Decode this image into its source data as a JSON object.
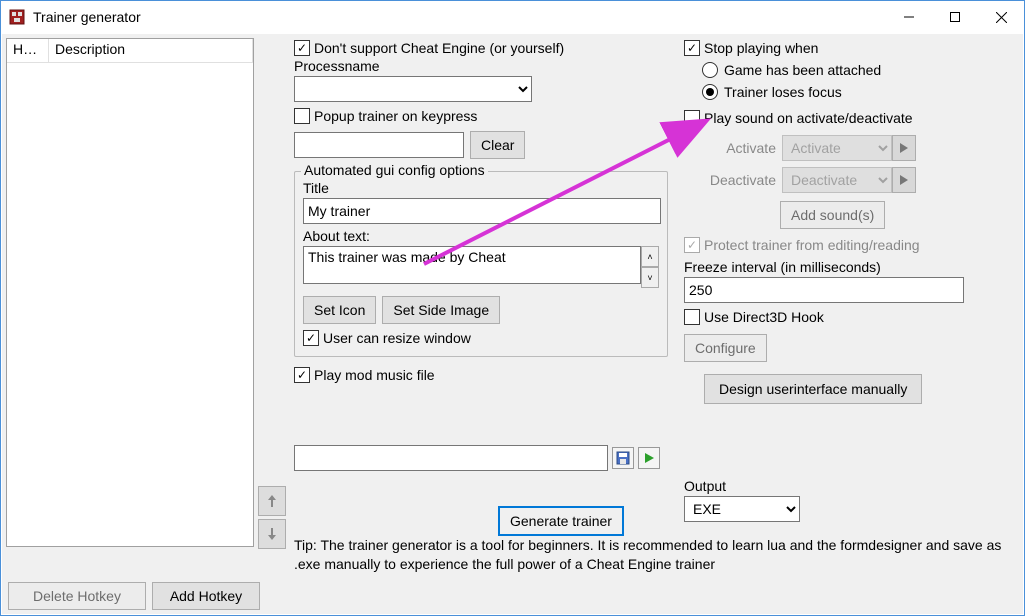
{
  "window": {
    "title": "Trainer generator"
  },
  "left": {
    "columns": {
      "ho": "Ho...",
      "desc": "Description"
    },
    "delete_hotkey": "Delete Hotkey",
    "add_hotkey": "Add Hotkey"
  },
  "left_col": {
    "dont_support": "Don't support Cheat Engine (or yourself)",
    "processname_label": "Processname",
    "processname_value": "",
    "popup_label": "Popup trainer on keypress",
    "popup_value": "",
    "clear": "Clear",
    "group_title": "Automated gui config options",
    "title_label": "Title",
    "title_value": "My trainer",
    "about_label": "About text:",
    "about_value": "This trainer was made by Cheat",
    "set_icon": "Set Icon",
    "set_side_image": "Set Side Image",
    "user_resize": "User can resize window",
    "play_mod": "Play mod music file",
    "mod_path": ""
  },
  "right_col": {
    "stop_playing": "Stop playing when",
    "radio_attached": "Game has been attached",
    "radio_focus": "Trainer loses focus",
    "play_sound": "Play sound on activate/deactivate",
    "activate_label": "Activate",
    "activate_select": "Activate",
    "deactivate_label": "Deactivate",
    "deactivate_select": "Deactivate",
    "add_sounds": "Add sound(s)",
    "protect": "Protect trainer from editing/reading",
    "freeze_label": "Freeze interval (in milliseconds)",
    "freeze_value": "250",
    "d3d_hook": "Use Direct3D Hook",
    "configure": "Configure",
    "design_ui": "Design userinterface manually",
    "output_label": "Output",
    "output_value": "EXE"
  },
  "bottom": {
    "generate": "Generate trainer",
    "tip": "Tip: The trainer generator is a tool for beginners. It is recommended to learn lua and the formdesigner and save as .exe manually to experience the full power of a Cheat Engine trainer"
  }
}
